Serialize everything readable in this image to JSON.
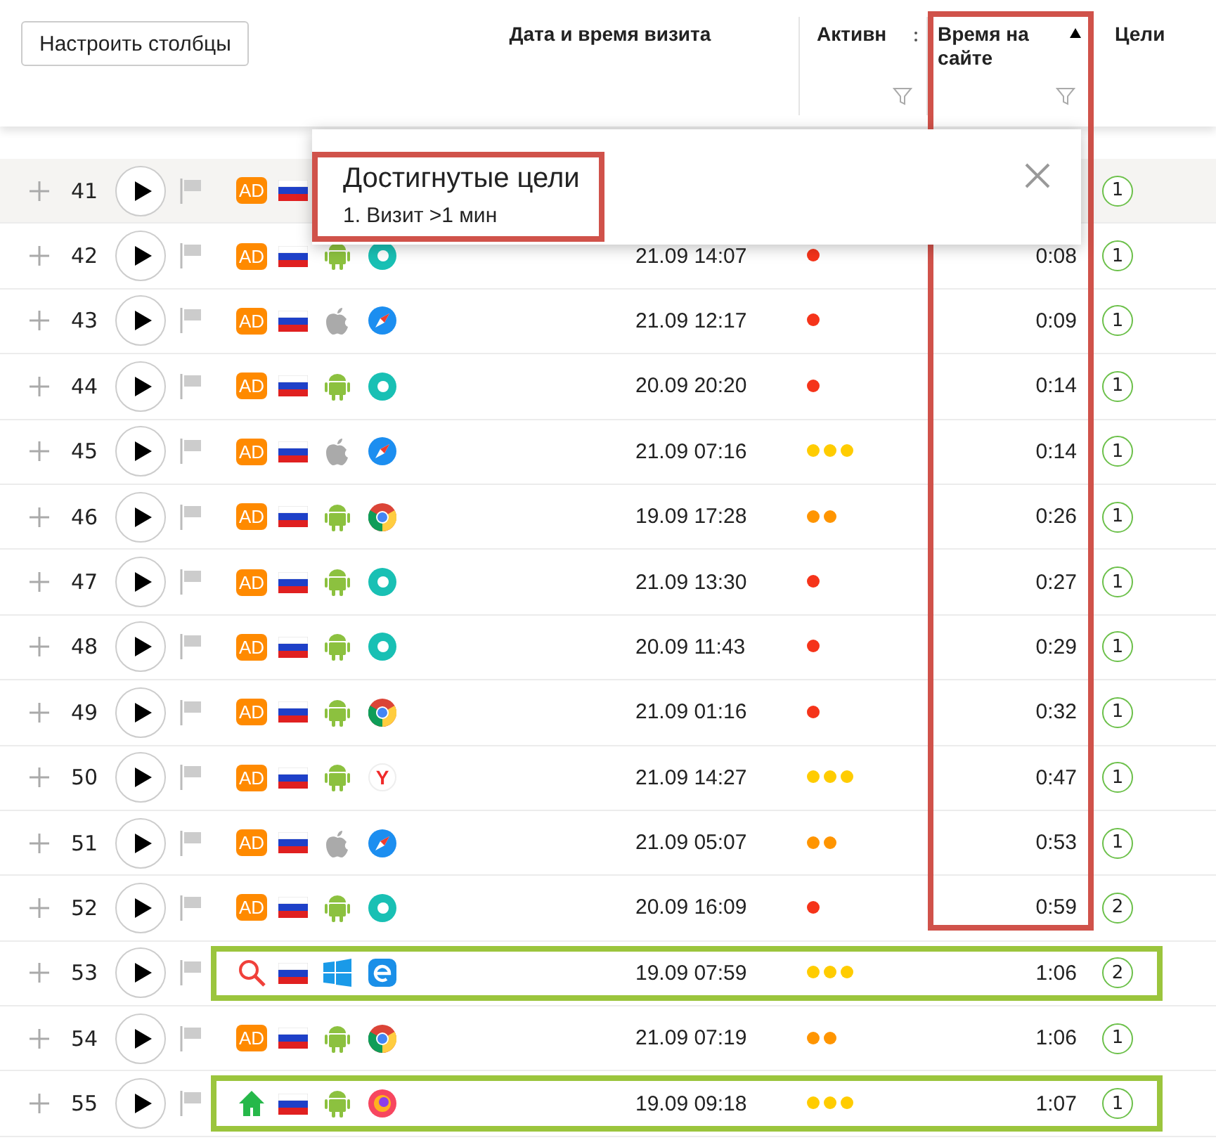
{
  "toolbar": {
    "columns_button": "Настроить столбцы"
  },
  "columns": [
    {
      "kind": "date",
      "label": "Дата и время визита"
    },
    {
      "kind": "activity",
      "label": "Активн",
      "filter": true
    },
    {
      "kind": "time",
      "label": "Время на сайте",
      "filter": true,
      "sort": true,
      "marked": true
    },
    {
      "kind": "goals",
      "label": "Цели"
    }
  ],
  "rows": [
    {
      "number": "41",
      "highlighted": true,
      "marked": false,
      "source": {
        "kind": "ad",
        "label": "AD"
      },
      "goals": "1"
    },
    {
      "number": "42",
      "highlighted": false,
      "marked": false,
      "source": {
        "kind": "ad",
        "label": "AD"
      },
      "os": {
        "kind": "android"
      },
      "browser": {
        "kind": "ring"
      },
      "date": "21.09 14:07",
      "activity": {
        "kind": "low"
      },
      "time": "0:08",
      "goals": "1"
    },
    {
      "number": "43",
      "highlighted": false,
      "marked": false,
      "source": {
        "kind": "ad",
        "label": "AD"
      },
      "os": {
        "kind": "apple"
      },
      "browser": {
        "kind": "compass"
      },
      "date": "21.09 12:17",
      "activity": {
        "kind": "low"
      },
      "time": "0:09",
      "goals": "1"
    },
    {
      "number": "44",
      "highlighted": false,
      "marked": false,
      "source": {
        "kind": "ad",
        "label": "AD"
      },
      "os": {
        "kind": "android"
      },
      "browser": {
        "kind": "ring"
      },
      "date": "20.09 20:20",
      "activity": {
        "kind": "low"
      },
      "time": "0:14",
      "goals": "1"
    },
    {
      "number": "45",
      "highlighted": false,
      "marked": false,
      "source": {
        "kind": "ad",
        "label": "AD"
      },
      "os": {
        "kind": "apple"
      },
      "browser": {
        "kind": "compass"
      },
      "date": "21.09 07:16",
      "activity": {
        "kind": "high"
      },
      "time": "0:14",
      "goals": "1"
    },
    {
      "number": "46",
      "highlighted": false,
      "marked": false,
      "source": {
        "kind": "ad",
        "label": "AD"
      },
      "os": {
        "kind": "android"
      },
      "browser": {
        "kind": "chrome"
      },
      "date": "19.09 17:28",
      "activity": {
        "kind": "medium"
      },
      "time": "0:26",
      "goals": "1"
    },
    {
      "number": "47",
      "highlighted": false,
      "marked": false,
      "source": {
        "kind": "ad",
        "label": "AD"
      },
      "os": {
        "kind": "android"
      },
      "browser": {
        "kind": "ring"
      },
      "date": "21.09 13:30",
      "activity": {
        "kind": "low"
      },
      "time": "0:27",
      "goals": "1"
    },
    {
      "number": "48",
      "highlighted": false,
      "marked": false,
      "source": {
        "kind": "ad",
        "label": "AD"
      },
      "os": {
        "kind": "android"
      },
      "browser": {
        "kind": "ring"
      },
      "date": "20.09 11:43",
      "activity": {
        "kind": "low"
      },
      "time": "0:29",
      "goals": "1"
    },
    {
      "number": "49",
      "highlighted": false,
      "marked": false,
      "source": {
        "kind": "ad",
        "label": "AD"
      },
      "os": {
        "kind": "android"
      },
      "browser": {
        "kind": "chrome"
      },
      "date": "21.09 01:16",
      "activity": {
        "kind": "low"
      },
      "time": "0:32",
      "goals": "1"
    },
    {
      "number": "50",
      "highlighted": false,
      "marked": false,
      "source": {
        "kind": "ad",
        "label": "AD"
      },
      "os": {
        "kind": "android"
      },
      "browser": {
        "kind": "y",
        "label": "Y"
      },
      "date": "21.09 14:27",
      "activity": {
        "kind": "high"
      },
      "time": "0:47",
      "goals": "1"
    },
    {
      "number": "51",
      "highlighted": false,
      "marked": false,
      "source": {
        "kind": "ad",
        "label": "AD"
      },
      "os": {
        "kind": "apple"
      },
      "browser": {
        "kind": "compass"
      },
      "date": "21.09 05:07",
      "activity": {
        "kind": "medium"
      },
      "time": "0:53",
      "goals": "1"
    },
    {
      "number": "52",
      "highlighted": false,
      "marked": false,
      "source": {
        "kind": "ad",
        "label": "AD"
      },
      "os": {
        "kind": "android"
      },
      "browser": {
        "kind": "ring"
      },
      "date": "20.09 16:09",
      "activity": {
        "kind": "low"
      },
      "time": "0:59",
      "goals": "2"
    },
    {
      "number": "53",
      "highlighted": false,
      "marked": true,
      "source": {
        "kind": "search"
      },
      "os": {
        "kind": "windows"
      },
      "browser": {
        "kind": "e"
      },
      "date": "19.09 07:59",
      "activity": {
        "kind": "high"
      },
      "time": "1:06",
      "goals": "2"
    },
    {
      "number": "54",
      "highlighted": false,
      "marked": false,
      "source": {
        "kind": "ad",
        "label": "AD"
      },
      "os": {
        "kind": "android"
      },
      "browser": {
        "kind": "chrome"
      },
      "date": "21.09 07:19",
      "activity": {
        "kind": "medium"
      },
      "time": "1:06",
      "goals": "1"
    },
    {
      "number": "55",
      "highlighted": false,
      "marked": true,
      "source": {
        "kind": "home"
      },
      "os": {
        "kind": "android"
      },
      "browser": {
        "kind": "fox"
      },
      "date": "19.09 09:18",
      "activity": {
        "kind": "high"
      },
      "time": "1:07",
      "goals": "1"
    }
  ],
  "popup": {
    "title": "Достигнутые цели",
    "items": [
      "1. Визит >1 мин"
    ],
    "marked": true
  }
}
